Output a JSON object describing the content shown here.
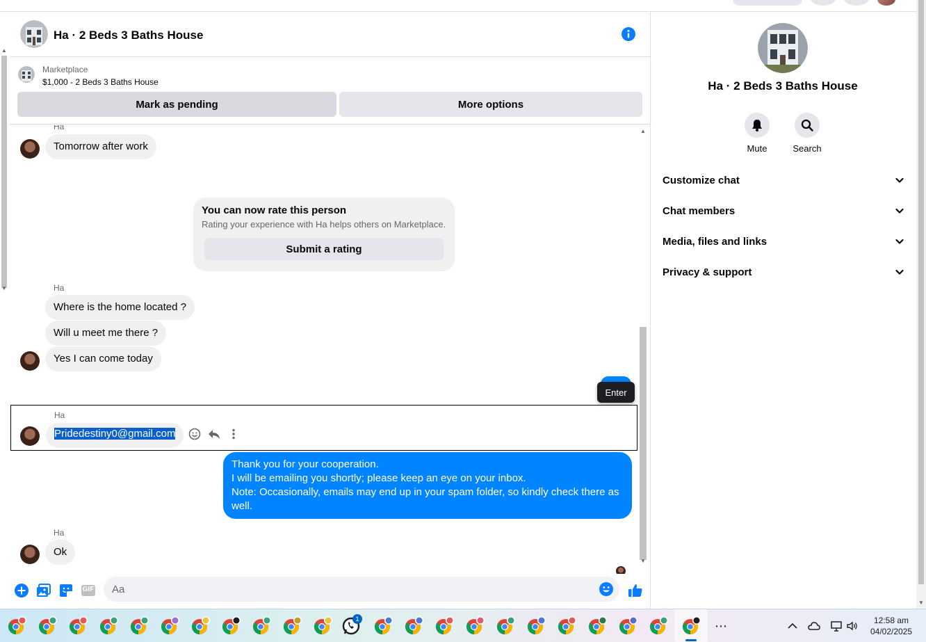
{
  "header": {
    "title": "Ha · 2 Beds 3 Baths House"
  },
  "listing": {
    "kicker": "Marketplace",
    "title": "$1,000 - 2 Beds 3 Baths House",
    "mark_pending_label": "Mark as pending",
    "more_options_label": "More options"
  },
  "messages": {
    "sender_name": "Ha",
    "m1": "Tomorrow after work",
    "rating_card": {
      "title": "You can now rate this person",
      "subtitle": "Rating your experience with Ha helps others on Marketplace.",
      "button": "Submit a rating"
    },
    "m2": "Where is the home located ?",
    "m3": "Will u meet me there ?",
    "m4": "Yes I can come today",
    "tooltip": "Enter",
    "m5_selected": "Pridedestiny0@gmail.com",
    "out_lines": [
      "Thank you for your cooperation.",
      "I will be emailing you shortly; please keep an eye on your inbox.",
      "Note: Occasionally, emails may end up in your spam folder, so kindly check there as well."
    ],
    "m6": "Ok"
  },
  "composer": {
    "placeholder": "Aa",
    "gif_label": "GIF"
  },
  "info_panel": {
    "title": "Ha · 2 Beds 3 Baths House",
    "mute_label": "Mute",
    "search_label": "Search",
    "sections": [
      "Customize chat",
      "Chat members",
      "Media, files and links",
      "Privacy & support"
    ]
  },
  "taskbar": {
    "whatsapp_badge": "1",
    "time": "12:58 am",
    "date": "04/02/2025",
    "more_glyph": "⋯"
  },
  "colors": {
    "messenger_blue": "#0084ff",
    "bubble_grey": "#f0f0f0",
    "button_grey": "#e4e6eb"
  }
}
